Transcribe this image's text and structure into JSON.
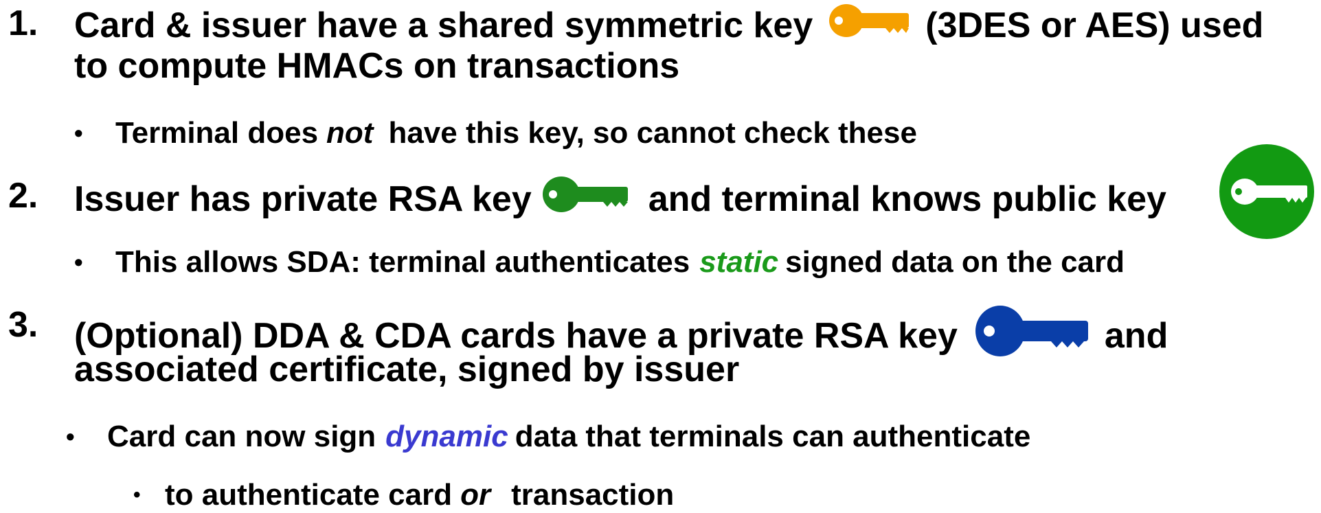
{
  "items": [
    {
      "number": "1.",
      "line1_a": "Card & issuer have a shared symmetric key",
      "line1_b": "(3DES or AES) used",
      "line2": "to compute HMACs on transactions",
      "bullet": {
        "pre": "Terminal does",
        "em": "not",
        "post": "have this key, so cannot check these"
      }
    },
    {
      "number": "2.",
      "line1_a": "Issuer has private RSA key",
      "line1_b": "and terminal knows public key",
      "bullet": {
        "pre": "This allows SDA: terminal authenticates",
        "em": "static",
        "post": "signed data on the card"
      }
    },
    {
      "number": "3.",
      "line1_a": "(Optional) DDA & CDA cards have a private RSA key",
      "line1_b": "and",
      "line2": "associated certificate, signed by issuer",
      "bullet": {
        "pre": "Card can now sign",
        "em": "dynamic",
        "post": "data that terminals can authenticate"
      },
      "subbullet": {
        "pre": "to authenticate card",
        "em": "or",
        "post": "transaction"
      }
    }
  ],
  "bullet_symbol": "•",
  "icons": {
    "symmetric_key": "orange-key-icon",
    "issuer_private_key": "green-key-icon",
    "terminal_public_key": "green-circle-key-icon",
    "card_private_key": "blue-key-icon"
  },
  "colors": {
    "symmetric_key": "#F5A000",
    "issuer_private_key": "#1E8C1E",
    "terminal_public_key": "#129A12",
    "card_private_key": "#0A3EA8",
    "static_text": "#1A9A1A",
    "dynamic_text": "#3A3AD0"
  }
}
